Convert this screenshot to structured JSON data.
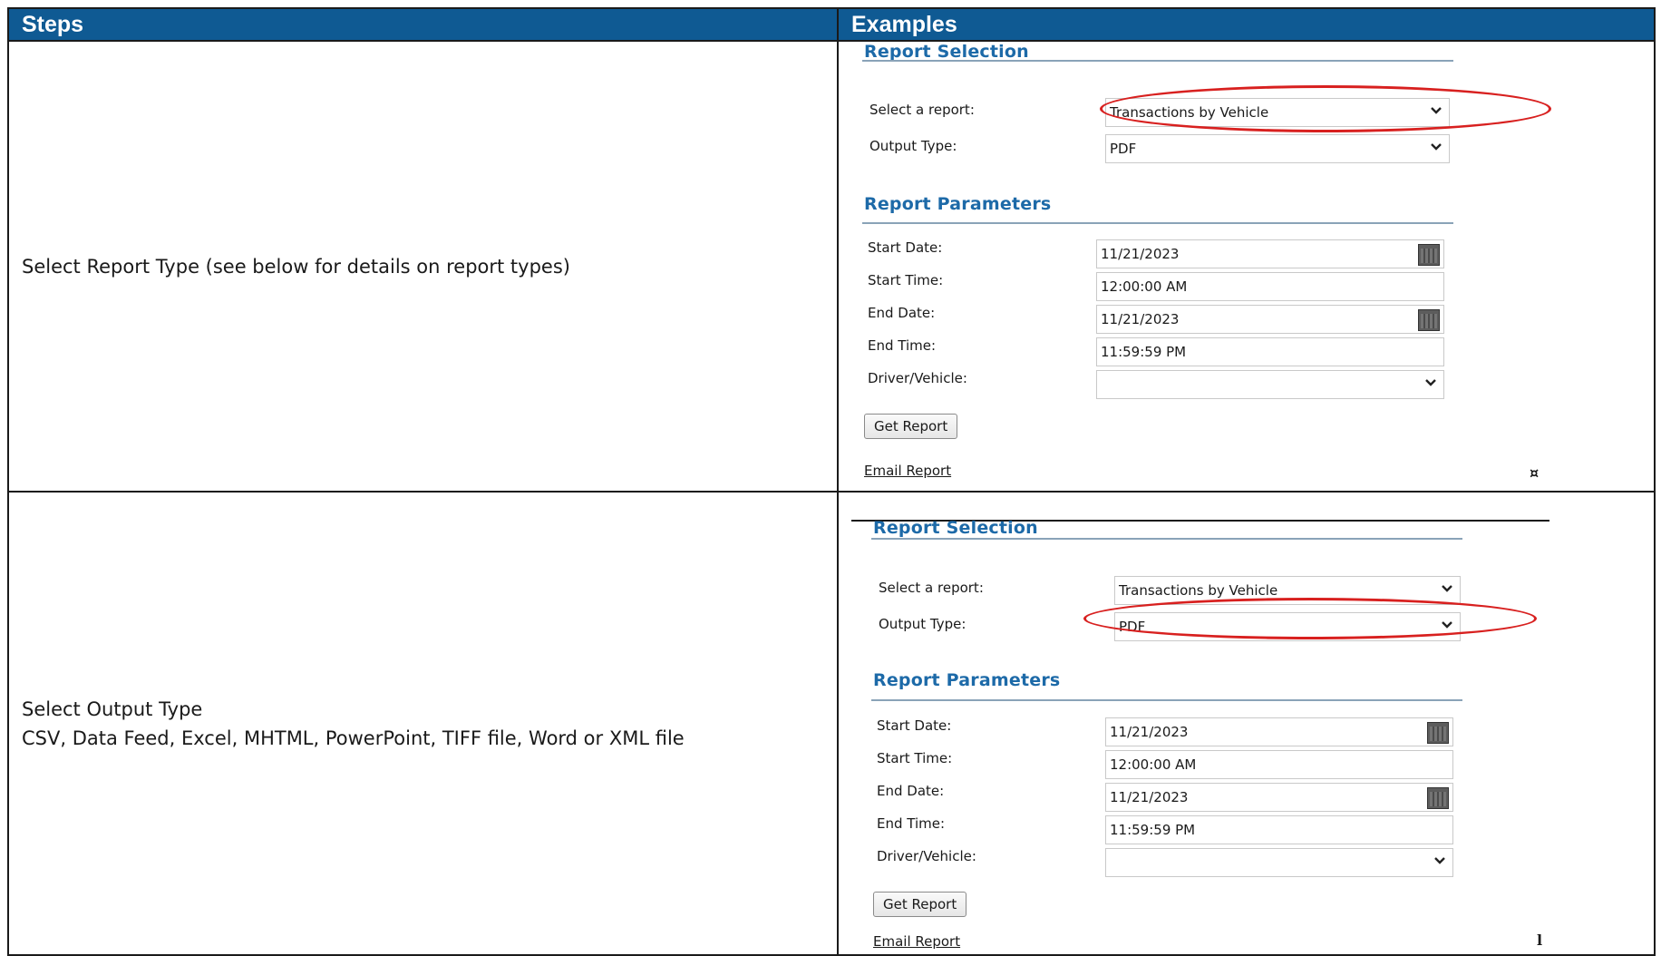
{
  "table": {
    "headers": [
      "Steps",
      "Examples"
    ],
    "rows": [
      {
        "step_lines": [
          "Select Report Type (see below for details on report types)"
        ],
        "example": {
          "report_selection_title": "Report Selection",
          "select_report_label": "Select a report:",
          "select_report_value": "Transactions by Vehicle",
          "output_type_label": "Output Type:",
          "output_type_value": "PDF",
          "report_parameters_title": "Report Parameters",
          "start_date_label": "Start Date:",
          "start_date_value": "11/21/2023",
          "start_time_label": "Start Time:",
          "start_time_value": "12:00:00 AM",
          "end_date_label": "End Date:",
          "end_date_value": "11/21/2023",
          "end_time_label": "End Time:",
          "end_time_value": "11:59:59 PM",
          "driver_vehicle_label": "Driver/Vehicle:",
          "driver_vehicle_value": "",
          "get_report_label": "Get Report",
          "email_report_label": "Email Report",
          "corner_glyph": "¤",
          "highlight": "select-report"
        }
      },
      {
        "step_lines": [
          "Select Output Type",
          "CSV, Data Feed, Excel, MHTML, PowerPoint, TIFF file, Word or XML file"
        ],
        "example": {
          "report_selection_title": "Report Selection",
          "select_report_label": "Select a report:",
          "select_report_value": "Transactions by Vehicle",
          "output_type_label": "Output Type:",
          "output_type_value": "PDF",
          "report_parameters_title": "Report Parameters",
          "start_date_label": "Start Date:",
          "start_date_value": "11/21/2023",
          "start_time_label": "Start Time:",
          "start_time_value": "12:00:00 AM",
          "end_date_label": "End Date:",
          "end_date_value": "11/21/2023",
          "end_time_label": "End Time:",
          "end_time_value": "11:59:59 PM",
          "driver_vehicle_label": "Driver/Vehicle:",
          "driver_vehicle_value": "",
          "get_report_label": "Get Report",
          "email_report_label": "Email Report",
          "corner_glyph": "l",
          "highlight": "output-type"
        }
      }
    ]
  },
  "colors": {
    "header_bg": "#0f5a93",
    "section_title": "#1d6aa8",
    "highlight_oval": "#d8201f"
  }
}
